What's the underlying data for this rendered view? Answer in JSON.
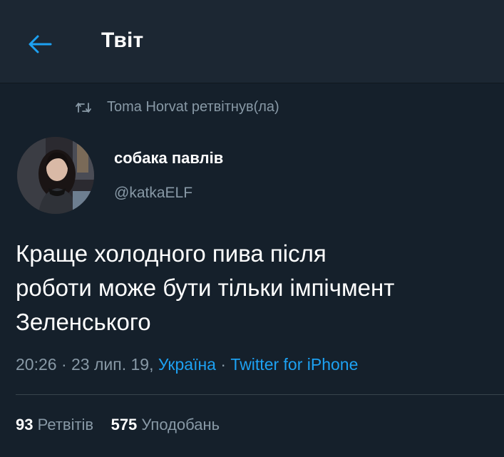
{
  "header": {
    "title": "Твіт",
    "back_icon": "arrow-left-icon",
    "accent": "#1da1f2"
  },
  "retweet": {
    "icon": "retweet-icon",
    "text": "Toma Horvat ретвітнув(ла)"
  },
  "tweet": {
    "author": {
      "display_name": "собака павлів",
      "handle": "@katkaELF"
    },
    "text": "Краще холодного пива після\nроботи може бути тільки імпічмент\nЗеленського",
    "time": "20:26",
    "sep1": " · ",
    "date": "23 лип. 19,",
    "location": "Україна",
    "sep2": " · ",
    "source": "Twitter for iPhone"
  },
  "stats": {
    "retweets_count": "93",
    "retweets_label": "Ретвітів",
    "likes_count": "575",
    "likes_label": "Уподобань"
  },
  "colors": {
    "background": "#15202b",
    "header_background": "#1c2733",
    "secondary_text": "#8899a6",
    "link": "#1da1f2"
  }
}
